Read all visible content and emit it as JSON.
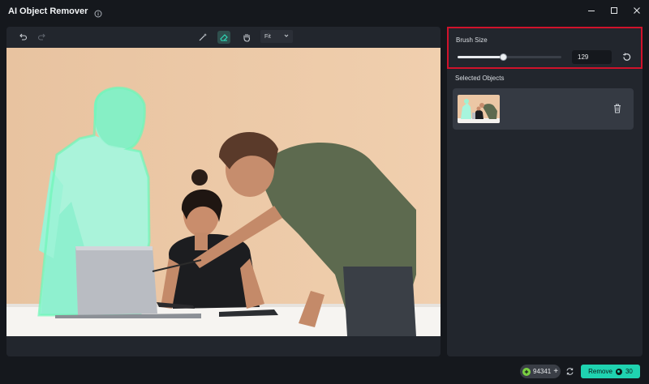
{
  "window": {
    "title": "AI Object Remover",
    "icons": [
      "info-icon",
      "minimize-icon",
      "maximize-icon",
      "close-icon"
    ]
  },
  "toolbar": {
    "icons": [
      "undo-icon",
      "redo-icon",
      "smart-brush-icon",
      "eraser-icon",
      "hand-icon"
    ],
    "active_tool": "eraser-icon",
    "zoom_value": "Fit"
  },
  "brush": {
    "label": "Brush Size",
    "value": "129",
    "slider_fraction": 0.44
  },
  "selected": {
    "label": "Selected Objects",
    "items": [
      {
        "icon": "trash-icon"
      }
    ]
  },
  "footer": {
    "credits": "94341",
    "remove_label": "Remove",
    "remove_cost": "30"
  },
  "colors": {
    "accent": "#1fd3b0",
    "highlight_border": "#d0122b",
    "mask": "#7dfbc6"
  }
}
